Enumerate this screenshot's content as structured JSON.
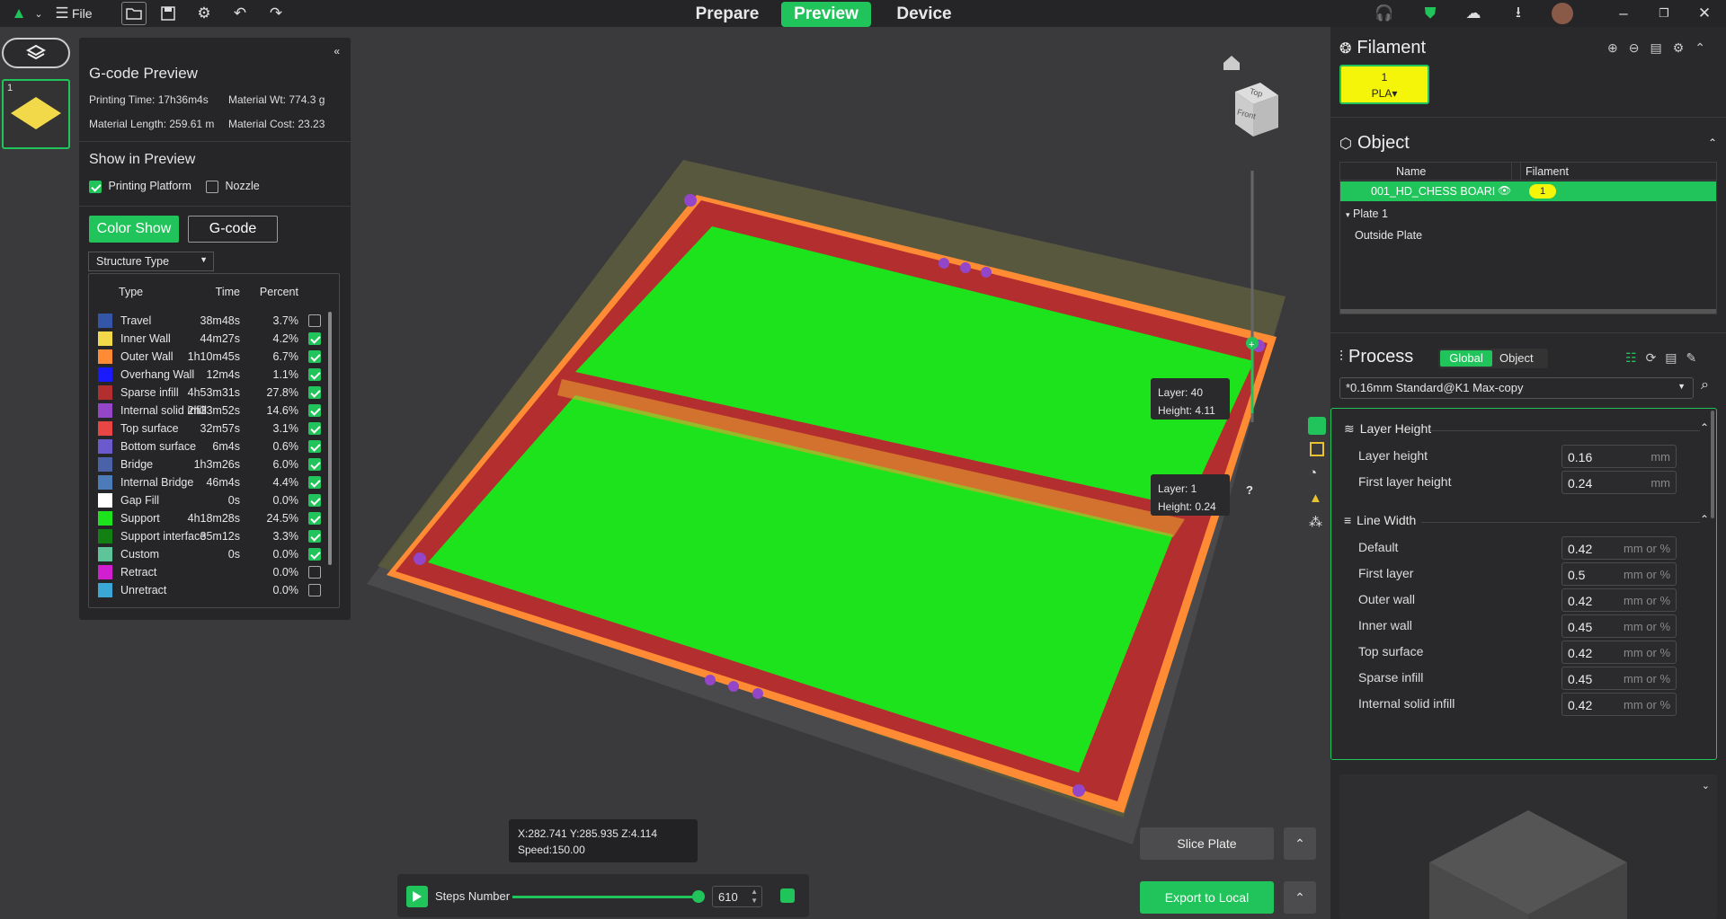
{
  "topbar": {
    "file_label": "File",
    "tabs": [
      "Prepare",
      "Preview",
      "Device"
    ],
    "active_tab": "Preview"
  },
  "plate": {
    "number": "1"
  },
  "gcode": {
    "title": "G-code Preview",
    "printing_time": "Printing Time: 17h36m4s",
    "material_wt": "Material Wt: 774.3 g",
    "material_length": "Material Length: 259.61 m",
    "material_cost": "Material Cost: 23.23",
    "show_title": "Show in Preview",
    "printing_platform": "Printing Platform",
    "nozzle": "Nozzle",
    "color_show": "Color Show",
    "gcode_btn": "G-code",
    "structure_type": "Structure Type",
    "headers": {
      "type": "Type",
      "time": "Time",
      "percent": "Percent"
    },
    "rows": [
      {
        "type": "Travel",
        "time": "38m48s",
        "percent": "3.7%",
        "color": "#3456a8",
        "checked": false
      },
      {
        "type": "Inner Wall",
        "time": "44m27s",
        "percent": "4.2%",
        "color": "#f2d94a",
        "checked": true
      },
      {
        "type": "Outer Wall",
        "time": "1h10m45s",
        "percent": "6.7%",
        "color": "#ff8c35",
        "checked": true
      },
      {
        "type": "Overhang Wall",
        "time": "12m4s",
        "percent": "1.1%",
        "color": "#1a1aff",
        "checked": true
      },
      {
        "type": "Sparse infill",
        "time": "4h53m31s",
        "percent": "27.8%",
        "color": "#b32e2e",
        "checked": true
      },
      {
        "type": "Internal solid infill",
        "time": "2h33m52s",
        "percent": "14.6%",
        "color": "#9346c8",
        "checked": true
      },
      {
        "type": "Top surface",
        "time": "32m57s",
        "percent": "3.1%",
        "color": "#e84545",
        "checked": true
      },
      {
        "type": "Bottom surface",
        "time": "6m4s",
        "percent": "0.6%",
        "color": "#6a5acd",
        "checked": true
      },
      {
        "type": "Bridge",
        "time": "1h3m26s",
        "percent": "6.0%",
        "color": "#4a63a8",
        "checked": true
      },
      {
        "type": "Internal Bridge",
        "time": "46m4s",
        "percent": "4.4%",
        "color": "#4d7ab8",
        "checked": true
      },
      {
        "type": "Gap Fill",
        "time": "0s",
        "percent": "0.0%",
        "color": "#ffffff",
        "checked": true
      },
      {
        "type": "Support",
        "time": "4h18m28s",
        "percent": "24.5%",
        "color": "#1de31d",
        "checked": true
      },
      {
        "type": "Support interface",
        "time": "35m12s",
        "percent": "3.3%",
        "color": "#128012",
        "checked": true
      },
      {
        "type": "Custom",
        "time": "0s",
        "percent": "0.0%",
        "color": "#5ec49a",
        "checked": true
      },
      {
        "type": "Retract",
        "time": "",
        "percent": "0.0%",
        "color": "#d01ed0",
        "checked": false
      },
      {
        "type": "Unretract",
        "time": "",
        "percent": "0.0%",
        "color": "#3aa7d6",
        "checked": false
      }
    ]
  },
  "layer_tips": {
    "top_layer": "Layer: 40",
    "top_height": "Height: 4.11",
    "bottom_layer": "Layer: 1",
    "bottom_height": "Height: 0.24"
  },
  "cube": {
    "top": "Top",
    "front": "Front"
  },
  "coords": {
    "xyz": "X:282.741  Y:285.935  Z:4.114",
    "speed": "Speed:150.00"
  },
  "steps": {
    "label": "Steps Number",
    "value": "610"
  },
  "actions": {
    "slice": "Slice Plate",
    "export": "Export to Local"
  },
  "filament": {
    "title": "Filament",
    "slot_num": "1",
    "slot_type": "PLA▾",
    "slot_color": "#f5f50a"
  },
  "object": {
    "title": "Object",
    "col_name": "Name",
    "col_filament": "Filament",
    "selected_name": "001_HD_CHESS BOARI",
    "selected_filament": "1",
    "tree": [
      "Plate 1",
      "Outside Plate"
    ]
  },
  "process": {
    "title": "Process",
    "toggle_global": "Global",
    "toggle_object": "Object",
    "preset": "*0.16mm Standard@K1 Max-copy",
    "groups": [
      {
        "title": "Layer Height",
        "params": [
          {
            "label": "Layer height",
            "value": "0.16",
            "unit": "mm"
          },
          {
            "label": "First layer height",
            "value": "0.24",
            "unit": "mm"
          }
        ]
      },
      {
        "title": "Line Width",
        "params": [
          {
            "label": "Default",
            "value": "0.42",
            "unit": "mm or %"
          },
          {
            "label": "First layer",
            "value": "0.5",
            "unit": "mm or %"
          },
          {
            "label": "Outer wall",
            "value": "0.42",
            "unit": "mm or %"
          },
          {
            "label": "Inner wall",
            "value": "0.45",
            "unit": "mm or %"
          },
          {
            "label": "Top surface",
            "value": "0.42",
            "unit": "mm or %"
          },
          {
            "label": "Sparse infill",
            "value": "0.45",
            "unit": "mm or %"
          },
          {
            "label": "Internal solid infill",
            "value": "0.42",
            "unit": "mm or %"
          }
        ]
      }
    ]
  },
  "colors": {
    "accent": "#21c45a",
    "panel": "#262628",
    "bg": "#3a3a3c"
  }
}
